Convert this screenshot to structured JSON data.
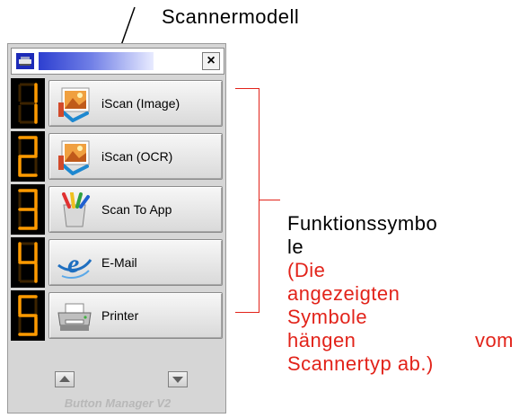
{
  "annotations": {
    "scanner_model": "Scannermodell",
    "function_icons": [
      "Funktionssymbo",
      "le"
    ],
    "note_lines": [
      "(Die",
      "angezeigten",
      "Symbole"
    ],
    "note_last_left": "hängen",
    "note_last_right": "vom",
    "note_tail": "Scannertyp ab.)",
    "accent_color": "#e2231a"
  },
  "window": {
    "close_symbol": "×",
    "footer": "Button Manager V2",
    "buttons": [
      {
        "digit": "1",
        "label": "iScan (Image)",
        "icon": "image-scan-icon"
      },
      {
        "digit": "2",
        "label": "iScan (OCR)",
        "icon": "ocr-scan-icon"
      },
      {
        "digit": "3",
        "label": "Scan To App",
        "icon": "app-icon"
      },
      {
        "digit": "4",
        "label": "E-Mail",
        "icon": "email-icon"
      },
      {
        "digit": "5",
        "label": "Printer",
        "icon": "printer-icon"
      }
    ]
  }
}
